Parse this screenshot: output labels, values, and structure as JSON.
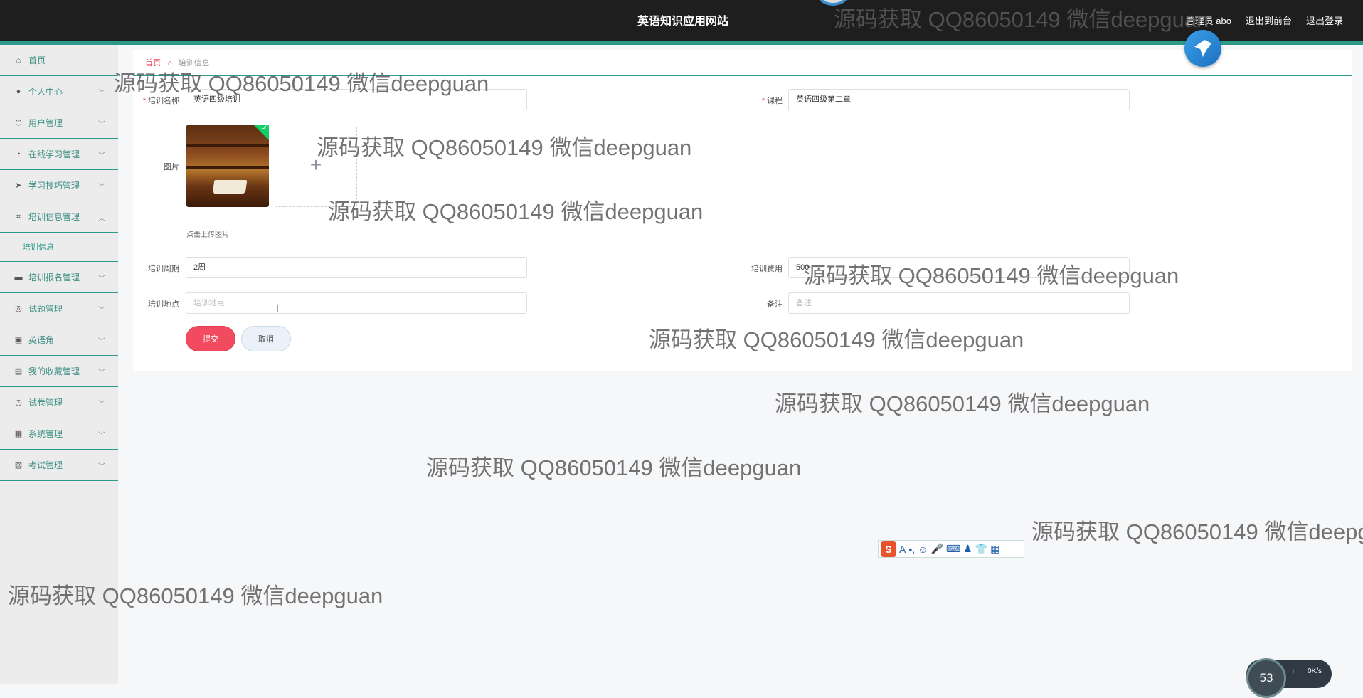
{
  "header": {
    "title": "英语知识应用网站",
    "user": "管理员 abo",
    "to_front": "退出到前台",
    "logout": "退出登录"
  },
  "sidebar": {
    "items": [
      {
        "label": "首页",
        "icon": "home-icon"
      },
      {
        "label": "个人中心",
        "icon": "user-icon"
      },
      {
        "label": "用户管理",
        "icon": "power-icon"
      },
      {
        "label": "在线学习管理",
        "icon": "gauge-icon"
      },
      {
        "label": "学习技巧管理",
        "icon": "send-icon"
      },
      {
        "label": "培训信息管理",
        "icon": "crop-icon"
      },
      {
        "label": "培训报名管理",
        "icon": "chat-icon"
      },
      {
        "label": "试题管理",
        "icon": "target-icon"
      },
      {
        "label": "英语角",
        "icon": "briefcase-icon"
      },
      {
        "label": "我的收藏管理",
        "icon": "book-icon"
      },
      {
        "label": "试卷管理",
        "icon": "clock-icon"
      },
      {
        "label": "系统管理",
        "icon": "clipboard-icon"
      },
      {
        "label": "考试管理",
        "icon": "clipboard-check-icon"
      }
    ],
    "submenu": "培训信息"
  },
  "breadcrumb": {
    "home": "首页",
    "current": "培训信息"
  },
  "form": {
    "name_label": "培训名称",
    "name_value": "英语四级培训",
    "course_label": "课程",
    "course_value": "英语四级第二章",
    "image_label": "图片",
    "upload_tip": "点击上传图片",
    "period_label": "培训周期",
    "period_value": "2周",
    "fee_label": "培训费用",
    "fee_value": "500",
    "place_label": "培训地点",
    "place_placeholder": "培训地点",
    "note_label": "备注",
    "note_placeholder": "备注",
    "submit": "提交",
    "cancel": "取消"
  },
  "watermark": "源码获取 QQ86050149 微信deepguan",
  "speed_widget": {
    "percent": "53",
    "rate": "0K/s"
  },
  "colors": {
    "accent": "#2b9a8a",
    "submit": "#f24a5e",
    "topbar": "#1e1e1e"
  }
}
